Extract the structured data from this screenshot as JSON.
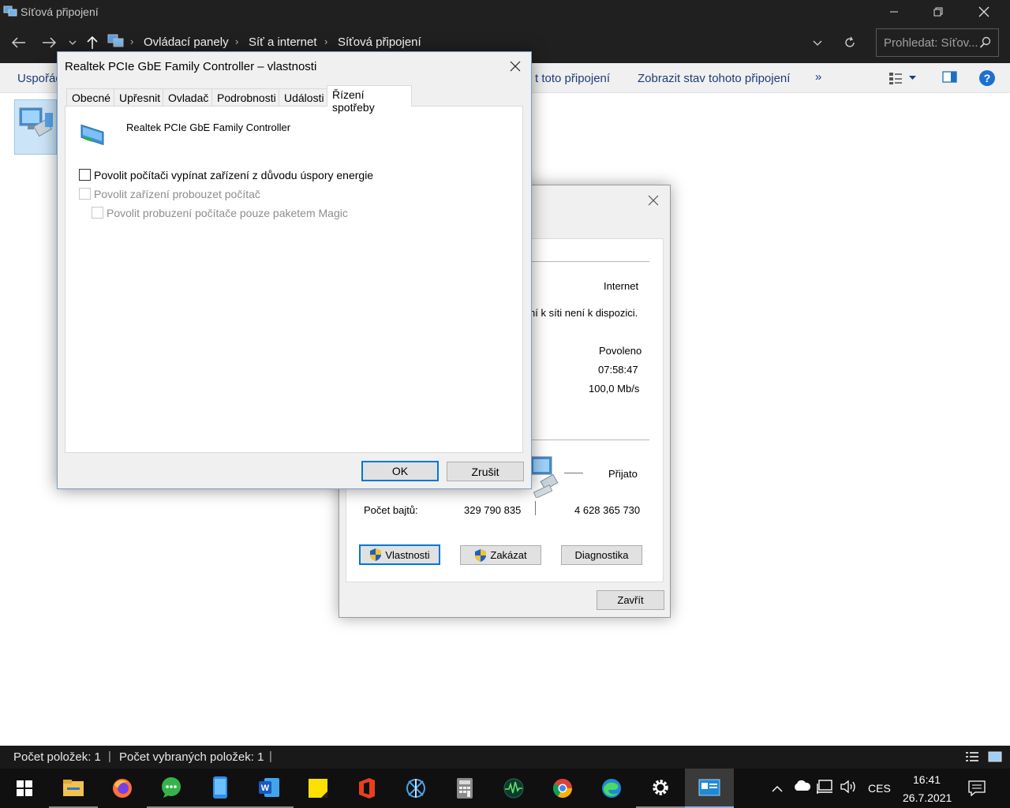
{
  "explorer": {
    "title": "Síťová připojení",
    "breadcrumb": [
      "Ovládací panely",
      "Síť a internet",
      "Síťová připojení"
    ],
    "search_placeholder": "Prohledat: Síťov...",
    "commands": {
      "organize": "Uspořád",
      "rename_partial": "t toto připojení",
      "view_status": "Zobrazit stav tohoto připojení",
      "more": "»"
    },
    "status": {
      "item_count": "Počet položek: 1",
      "selected_count": "Počet vybraných položek: 1"
    }
  },
  "status_dialog": {
    "internet": "Internet",
    "no_access": "ní k síti není k dispozici.",
    "media_state": "Povoleno",
    "duration": "07:58:47",
    "speed": "100,0 Mb/s",
    "received_label": "Přijato",
    "bytes_label": "Počet bajtů:",
    "bytes_sent": "329 790 835",
    "bytes_received": "4 628 365 730",
    "btn_properties": "Vlastnosti",
    "btn_disable": "Zakázat",
    "btn_diagnose": "Diagnostika",
    "btn_close": "Zavřít"
  },
  "properties_dialog": {
    "title": "Realtek PCIe GbE Family Controller – vlastnosti",
    "tabs": [
      "Obecné",
      "Upřesnit",
      "Ovladač",
      "Podrobnosti",
      "Události",
      "Řízení spotřeby"
    ],
    "selected_tab": "Řízení spotřeby",
    "device_name": "Realtek PCIe GbE Family Controller",
    "options": [
      {
        "label": "Povolit počítači vypínat zařízení z důvodu úspory energie",
        "checked": false,
        "enabled": true
      },
      {
        "label": "Povolit zařízení probouzet počítač",
        "checked": false,
        "enabled": false
      },
      {
        "label": "Povolit probuzení počítače pouze paketem Magic",
        "checked": false,
        "enabled": false
      }
    ],
    "ok": "OK",
    "cancel": "Zrušit"
  },
  "taskbar": {
    "lang": "CES",
    "time": "16:41",
    "date": "26.7.2021",
    "apps": [
      "start-icon",
      "file-explorer-icon",
      "firefox-icon",
      "chat-icon",
      "phone-icon",
      "word-icon",
      "sticky-notes-icon",
      "office-icon",
      "network-tool-icon",
      "calculator-icon",
      "monitor-icon",
      "chrome-icon",
      "edge-icon",
      "settings-icon",
      "network-connections-icon"
    ]
  },
  "colors": {
    "dark_chrome": "#202020",
    "accent": "#0078d7",
    "link": "#1a3e7a"
  }
}
